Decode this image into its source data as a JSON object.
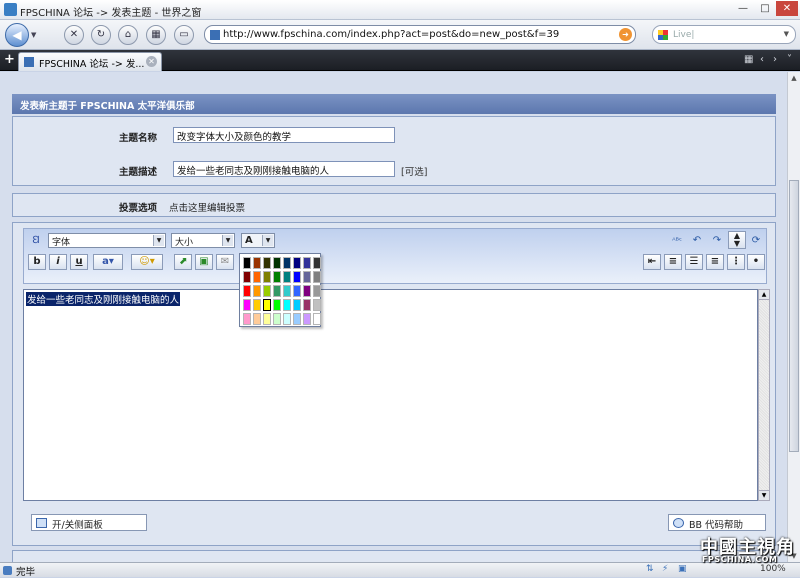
{
  "window": {
    "title": "FPSCHINA 论坛 -> 发表主题 - 世界之窗",
    "minimize": "—",
    "maximize": "□",
    "close": "✕"
  },
  "nav": {
    "url": "http://www.fpschina.com/index.php?act=post&do=new_post&f=39",
    "search_placeholder": "Live|"
  },
  "tab": {
    "label": "FPSCHINA 论坛 -> 发..."
  },
  "post": {
    "header": "发表新主题于 FPSCHINA 太平洋俱乐部",
    "title_label": "主题名称",
    "title_value": "改变字体大小及颜色的教学",
    "desc_label": "主题描述",
    "desc_value": "发给一些老同志及刚刚接触电脑的人",
    "optional": "[可选]",
    "poll_label": "投票选项",
    "poll_link": "点击这里编辑投票"
  },
  "editor": {
    "font_select": "字体",
    "size_select": "大小",
    "color_btn": "A",
    "bold": "b",
    "italic": "i",
    "underline": "u",
    "content": "发给一些老同志及刚刚接触电脑的人",
    "toggle_panel": "开/关侧面板",
    "bb_help": "BB 代码帮助"
  },
  "palette": {
    "colors": [
      [
        "#000000",
        "#993300",
        "#333300",
        "#003300",
        "#003366",
        "#000080",
        "#333399",
        "#333333"
      ],
      [
        "#800000",
        "#ff6600",
        "#808000",
        "#008000",
        "#008080",
        "#0000ff",
        "#666699",
        "#808080"
      ],
      [
        "#ff0000",
        "#ff9900",
        "#99cc00",
        "#339966",
        "#33cccc",
        "#3366ff",
        "#800080",
        "#999999"
      ],
      [
        "#ff00ff",
        "#ffcc00",
        "#ffff00",
        "#00ff00",
        "#00ffff",
        "#00ccff",
        "#993366",
        "#c0c0c0"
      ],
      [
        "#ff99cc",
        "#ffcc99",
        "#ffff99",
        "#ccffcc",
        "#ccffff",
        "#99ccff",
        "#cc99ff",
        "#ffffff"
      ]
    ],
    "selected": "#ffff00"
  },
  "status": {
    "text": "完毕",
    "zoom": "100%"
  },
  "watermark": {
    "brand": "中國主視角",
    "site": "FPSCHINA.COM"
  }
}
